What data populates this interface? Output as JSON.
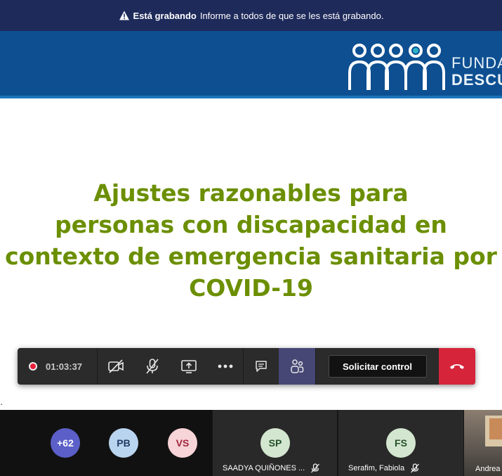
{
  "recording_banner": {
    "label_bold": "Está grabando",
    "message": "Informe a todos de que se les está grabando.",
    "icon": "warning-icon"
  },
  "slide": {
    "logo_text_line1": "FUNDA",
    "logo_text_line2": "DESCU",
    "title_lines": [
      "Ajustes razonables para",
      "personas con discapacidad en",
      "contexto de emergencia sanitaria por",
      "COVID-19"
    ],
    "edge_mark": "·",
    "colors": {
      "header": "#0d4f91",
      "title": "#6b8f00"
    }
  },
  "toolbar": {
    "timer": "01:03:37",
    "buttons": [
      "camera-off-icon",
      "mic-off-icon",
      "share-screen-icon",
      "more-icon",
      "chat-icon",
      "participants-icon"
    ],
    "control_label": "Solicitar control",
    "hangup_icon": "hangup-icon",
    "colors": {
      "hangup": "#d6243b",
      "active": "#464775",
      "record": "#e8203a"
    }
  },
  "participants": {
    "group": [
      {
        "initials": "+62",
        "bg": "#5b5fc7",
        "fg": "#ffffff"
      },
      {
        "initials": "PB",
        "bg": "#b9d4ef",
        "fg": "#1f3b63"
      },
      {
        "initials": "VS",
        "bg": "#f7d4d8",
        "fg": "#a1273c"
      }
    ],
    "tiles": [
      {
        "initials": "SP",
        "name": "SAADYA QUIÑONES ...",
        "bg": "#d3e6cf",
        "fg": "#26512a"
      },
      {
        "initials": "FS",
        "name": "Serafim, Fabiola",
        "bg": "#d3e6cf",
        "fg": "#26512a"
      }
    ],
    "video_name": "Andrea"
  }
}
